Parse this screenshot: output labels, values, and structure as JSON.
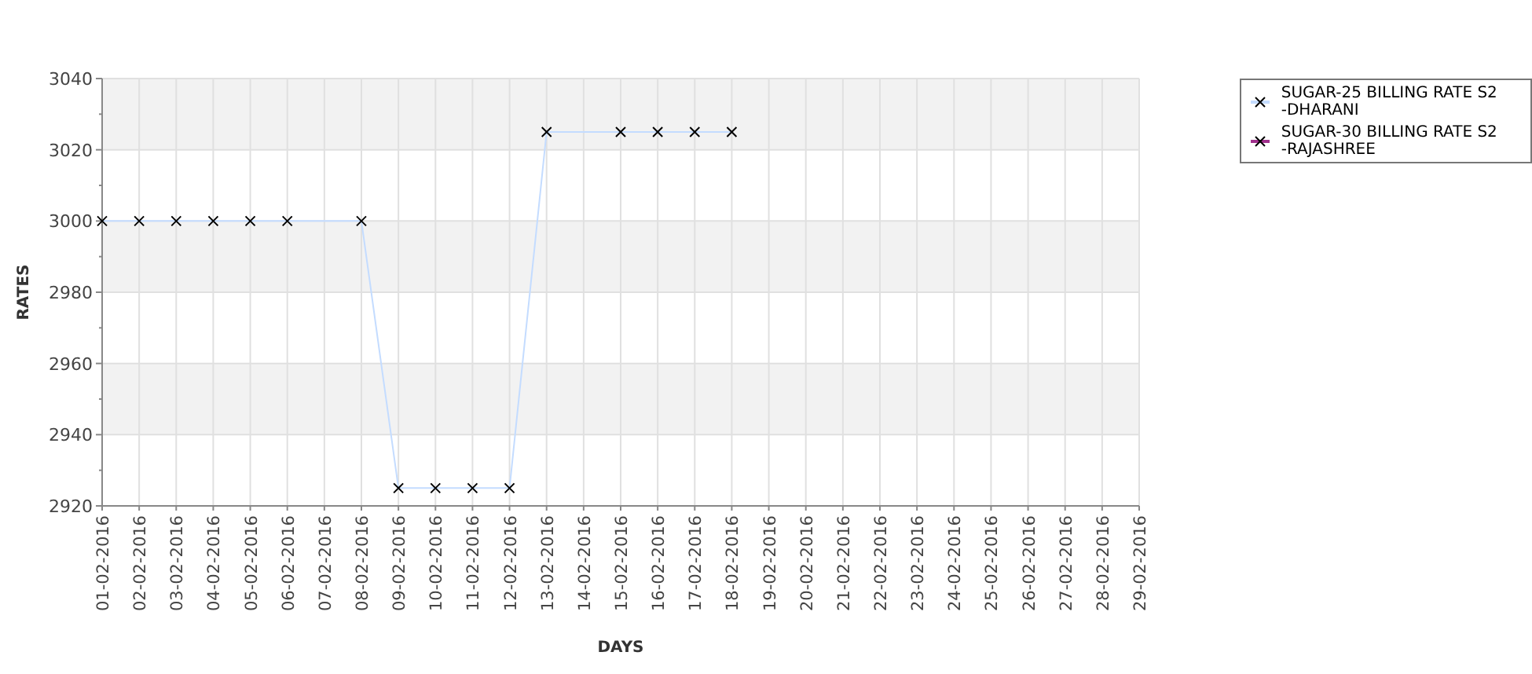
{
  "chart_data": {
    "type": "line",
    "xlabel": "DAYS",
    "ylabel": "RATES",
    "categories": [
      "01-02-2016",
      "02-02-2016",
      "03-02-2016",
      "04-02-2016",
      "05-02-2016",
      "06-02-2016",
      "07-02-2016",
      "08-02-2016",
      "09-02-2016",
      "10-02-2016",
      "11-02-2016",
      "12-02-2016",
      "13-02-2016",
      "14-02-2016",
      "15-02-2016",
      "16-02-2016",
      "17-02-2016",
      "18-02-2016",
      "19-02-2016",
      "20-02-2016",
      "21-02-2016",
      "22-02-2016",
      "23-02-2016",
      "24-02-2016",
      "25-02-2016",
      "26-02-2016",
      "27-02-2016",
      "28-02-2016",
      "29-02-2016"
    ],
    "series": [
      {
        "name": "SUGAR-25 BILLING RATE S2 -DHARANI",
        "color": "#c4dcff",
        "marker": "x",
        "values": [
          3000,
          3000,
          3000,
          3000,
          3000,
          3000,
          null,
          3000,
          2925,
          2925,
          2925,
          2925,
          3025,
          null,
          3025,
          3025,
          3025,
          3025,
          null,
          null,
          null,
          null,
          null,
          null,
          null,
          null,
          null,
          null,
          null
        ]
      },
      {
        "name": "SUGAR-30 BILLING RATE S2 -RAJASHREE",
        "color": "#a0308c",
        "marker": "x",
        "values": [
          null,
          null,
          null,
          null,
          null,
          null,
          null,
          null,
          null,
          null,
          null,
          null,
          null,
          null,
          null,
          null,
          null,
          null,
          null,
          null,
          null,
          null,
          null,
          null,
          null,
          null,
          null,
          null,
          null
        ]
      }
    ],
    "grid": true,
    "ylim": [
      2920,
      3040
    ],
    "yticks": [
      2920,
      2940,
      2960,
      2980,
      3000,
      3020,
      3040
    ]
  }
}
